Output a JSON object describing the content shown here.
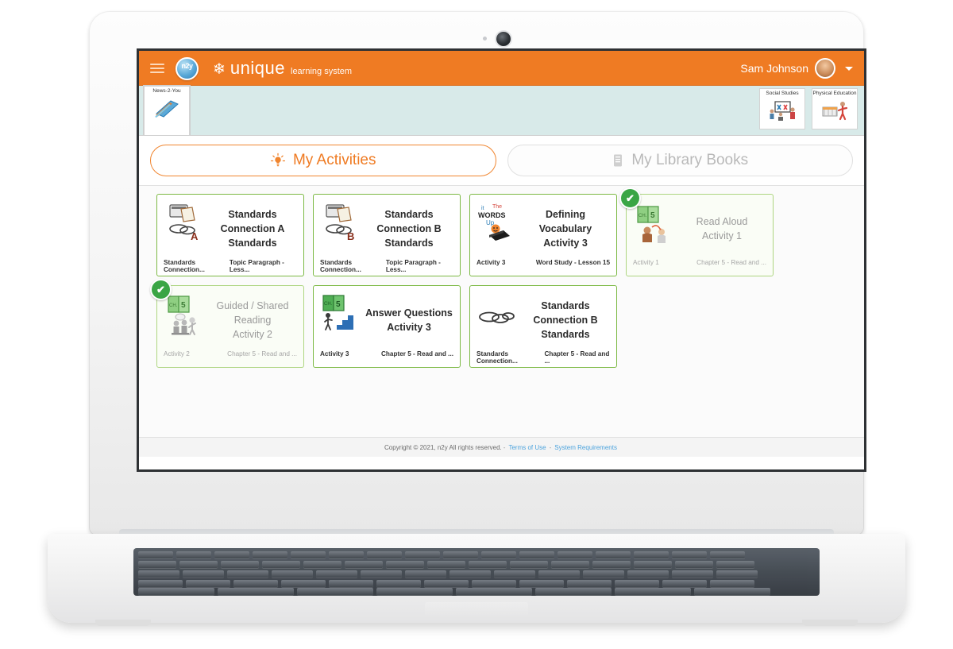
{
  "app": {
    "brand_name": "unique",
    "brand_sub": "learning system",
    "logo_text": "n2y",
    "menu_icon": "hamburger-icon",
    "snowflake_icon": "❄"
  },
  "user": {
    "name": "Sam Johnson",
    "avatar_icon": "user-avatar",
    "caret_icon": "chevron-down-icon"
  },
  "subject_band": {
    "active": {
      "label": "News-2-You",
      "icon": "newspaper-icon"
    },
    "right": [
      {
        "label": "Social Studies",
        "icon": "classroom-board-icon"
      },
      {
        "label": "Physical Education",
        "icon": "gym-icon"
      }
    ]
  },
  "tabs": [
    {
      "label": "My Activities",
      "icon": "lightbulb-icon",
      "active": true
    },
    {
      "label": "My Library Books",
      "icon": "book-icon",
      "active": false
    }
  ],
  "cards": [
    {
      "title": [
        "Standards",
        "Connection A",
        "Standards"
      ],
      "foot_left": "Standards Connection...",
      "foot_right": "Topic Paragraph - Less...",
      "icon": "standards-chain-a-icon",
      "completed": false
    },
    {
      "title": [
        "Standards",
        "Connection B",
        "Standards"
      ],
      "foot_left": "Standards Connection...",
      "foot_right": "Topic Paragraph - Less...",
      "icon": "standards-chain-b-icon",
      "completed": false
    },
    {
      "title": [
        "Defining",
        "Vocabulary",
        "Activity 3"
      ],
      "foot_left": "Activity 3",
      "foot_right": "Word Study - Lesson 15",
      "icon": "words-up-book-icon",
      "completed": false
    },
    {
      "title": [
        "Read Aloud",
        "Activity 1"
      ],
      "foot_left": "Activity 1",
      "foot_right": "Chapter 5 - Read and ...",
      "icon": "read-aloud-icon",
      "completed": true
    },
    {
      "title": [
        "Guided / Shared",
        "Reading",
        "Activity 2"
      ],
      "foot_left": "Activity 2",
      "foot_right": "Chapter 5 - Read and ...",
      "icon": "guided-reading-icon",
      "completed": true
    },
    {
      "title": [
        "Answer Questions",
        "Activity 3"
      ],
      "foot_left": "Activity 3",
      "foot_right": "Chapter 5 - Read and ...",
      "icon": "answer-questions-icon",
      "completed": false
    },
    {
      "title": [
        "Standards",
        "Connection B",
        "Standards"
      ],
      "foot_left": "Standards Connection...",
      "foot_right": "Chapter 5 - Read and ...",
      "icon": "standards-chain-icon",
      "completed": false
    }
  ],
  "badge": {
    "check_glyph": "✔"
  },
  "footer": {
    "copyright": "Copyright © 2021, n2y All rights reserved.",
    "sep1": "-",
    "terms_label": "Terms of Use",
    "sep2": "-",
    "requirements_label": "System Requirements"
  },
  "colors": {
    "brand_orange": "#ef7b23",
    "band_teal": "#d8eae9",
    "card_green": "#7cb944",
    "badge_green": "#3aa545",
    "link_blue": "#4ca3dd"
  }
}
